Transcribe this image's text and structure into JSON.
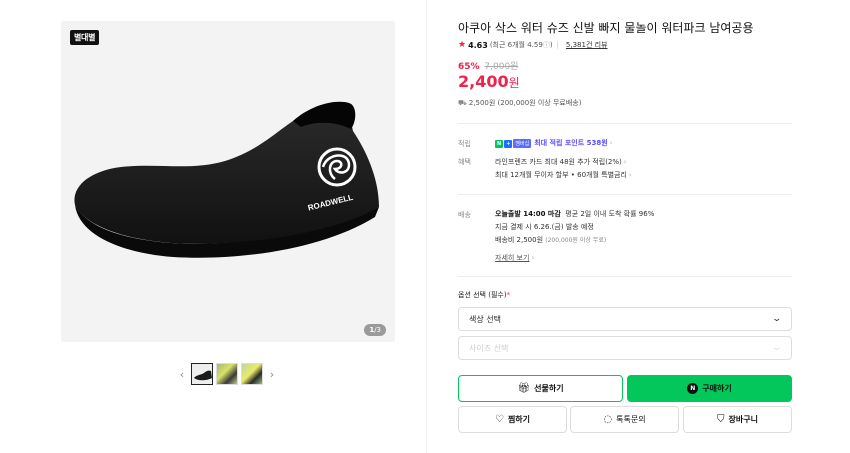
{
  "gallery": {
    "brand_badge": "별대별",
    "page_current": "1",
    "page_total": "/3",
    "shoe_logo_text": "ROADWELL",
    "prev_arrow": "‹",
    "next_arrow": "›"
  },
  "product": {
    "title": "아쿠아 삭스 워터 슈즈 신발 빠지 물놀이 워터파크 남여공용",
    "rating": "4.63",
    "rating_recent": "(최근 6개월 4.59",
    "rating_recent_close": ")",
    "review_count": "5,381건 리뷰",
    "discount": "65%",
    "original_price": "7,000원",
    "price": "2,400",
    "price_unit": "원",
    "shipping_fee": "2,500원 (200,000원 이상 무료배송)"
  },
  "benefits": {
    "points_label": "적립",
    "points_text": "최대 적립 포인트 538원",
    "points_badge1": "N",
    "points_badge2": "+",
    "points_badge3": "멤버십",
    "benefit_label": "혜택",
    "benefit_line1": "라인프렌즈 카드 최대 48원 추가 적립(2%)",
    "benefit_line2": "최대 12개월 무이자 할부 • 60개월 특별금리"
  },
  "delivery": {
    "label": "배송",
    "line1_bold": "오늘출발 14:00 마감",
    "line1_rest": "평균 2일 이내 도착 확률 96%",
    "line2": "지금 결제 시 6.26.(금) 발송 예정",
    "line3": "배송비 2,500원",
    "line3_small": "(200,000원 이상 무료)",
    "more": "자세히 보기"
  },
  "options": {
    "label": "옵션 선택 (필수)",
    "required_mark": "*",
    "color_select": "색상 선택",
    "size_select": "사이즈 선택"
  },
  "actions": {
    "gift": "선물하기",
    "buy": "구매하기",
    "zzim": "찜하기",
    "talk": "톡톡문의",
    "cart": "장바구니"
  },
  "colors": {
    "accent_red": "#f0224c",
    "naver_green": "#03c75a",
    "point_purple": "#5b4cff"
  },
  "icons": [
    "star-icon",
    "truck-icon",
    "gift-icon",
    "naver-n-icon",
    "heart-icon",
    "chat-icon",
    "cart-icon",
    "chevron-down-icon",
    "chevron-left-icon",
    "chevron-right-icon"
  ]
}
